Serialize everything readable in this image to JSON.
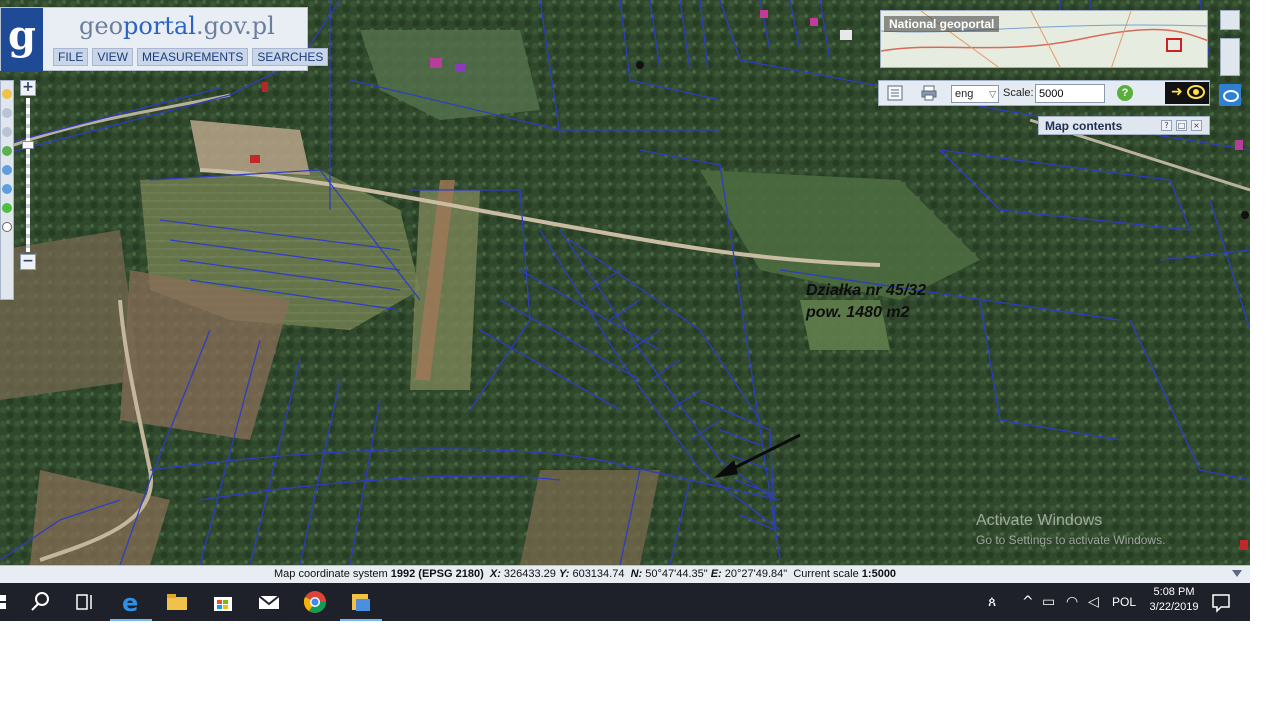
{
  "app": {
    "logo_letter": "g",
    "logo_prefix": "geo",
    "logo_highlight": "portal",
    "logo_suffix": ".gov.pl"
  },
  "menu": {
    "items": [
      {
        "label": "FILE"
      },
      {
        "label": "VIEW"
      },
      {
        "label": "MEASUREMENTS"
      },
      {
        "label": "SEARCHES"
      }
    ]
  },
  "overview": {
    "title": "National geoportal"
  },
  "toolbar": {
    "language": "eng",
    "scale_label": "Scale:",
    "scale_value": "5000",
    "help_label": "?",
    "nav_arrow": "➜"
  },
  "zoom": {
    "plus_label": "+",
    "minus_label": "−"
  },
  "map_contents": {
    "title": "Map contents",
    "help": "?",
    "restore": "□",
    "close": "×"
  },
  "annotation": {
    "line1": "Działka nr 45/32",
    "line2": "pow. 1480 m2"
  },
  "watermark": {
    "title": "Activate Windows",
    "subtitle": "Go to Settings to activate Windows."
  },
  "status": {
    "coord_system_label": "Map coordinate system",
    "coord_system_value": "1992 (EPSG 2180)",
    "x_label": "X:",
    "x_value": "326433.29",
    "y_label": "Y:",
    "y_value": "603134.74",
    "n_label": "N:",
    "n_value": "50°47'44.35\"",
    "e_label": "E:",
    "e_value": "20°27'49.84\"",
    "scale_label": "Current scale",
    "scale_value": "1:5000"
  },
  "taskbar": {
    "language": "POL",
    "time": "5:08 PM",
    "date": "3/22/2019"
  },
  "colors": {
    "parcel_lines": "#2d3cc8",
    "forest": "#2f4a2b",
    "field": "#6b7a4a",
    "accent_blue": "#1f4a96"
  }
}
